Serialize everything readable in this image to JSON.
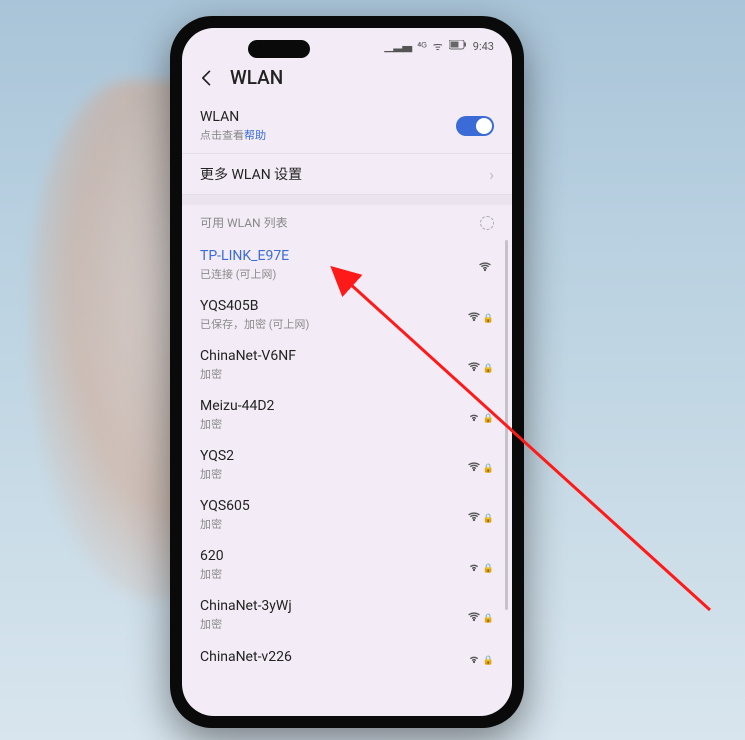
{
  "status_bar": {
    "signal": "⁴ᴳ",
    "icons": "ᯤ",
    "battery": "61",
    "time": "9:43"
  },
  "header": {
    "title": "WLAN"
  },
  "wlan_switch": {
    "label": "WLAN",
    "help_prefix": "点击查看",
    "help_link": "帮助",
    "enabled": true
  },
  "more_settings": {
    "label": "更多 WLAN 设置"
  },
  "list_header": "可用 WLAN 列表",
  "networks": [
    {
      "ssid": "TP-LINK_E97E",
      "sub": "已连接 (可上网)",
      "connected": true,
      "locked": false,
      "strength": 3
    },
    {
      "ssid": "YQS405B",
      "sub": "已保存，加密 (可上网)",
      "connected": false,
      "locked": true,
      "strength": 3
    },
    {
      "ssid": "ChinaNet-V6NF",
      "sub": "加密",
      "connected": false,
      "locked": true,
      "strength": 3
    },
    {
      "ssid": "Meizu-44D2",
      "sub": "加密",
      "connected": false,
      "locked": true,
      "strength": 2
    },
    {
      "ssid": "YQS2",
      "sub": "加密",
      "connected": false,
      "locked": true,
      "strength": 3
    },
    {
      "ssid": "YQS605",
      "sub": "加密",
      "connected": false,
      "locked": true,
      "strength": 3
    },
    {
      "ssid": "620",
      "sub": "加密",
      "connected": false,
      "locked": true,
      "strength": 2
    },
    {
      "ssid": "ChinaNet-3yWj",
      "sub": "加密",
      "connected": false,
      "locked": true,
      "strength": 3
    },
    {
      "ssid": "ChinaNet-v226",
      "sub": "",
      "connected": false,
      "locked": true,
      "strength": 2
    }
  ]
}
